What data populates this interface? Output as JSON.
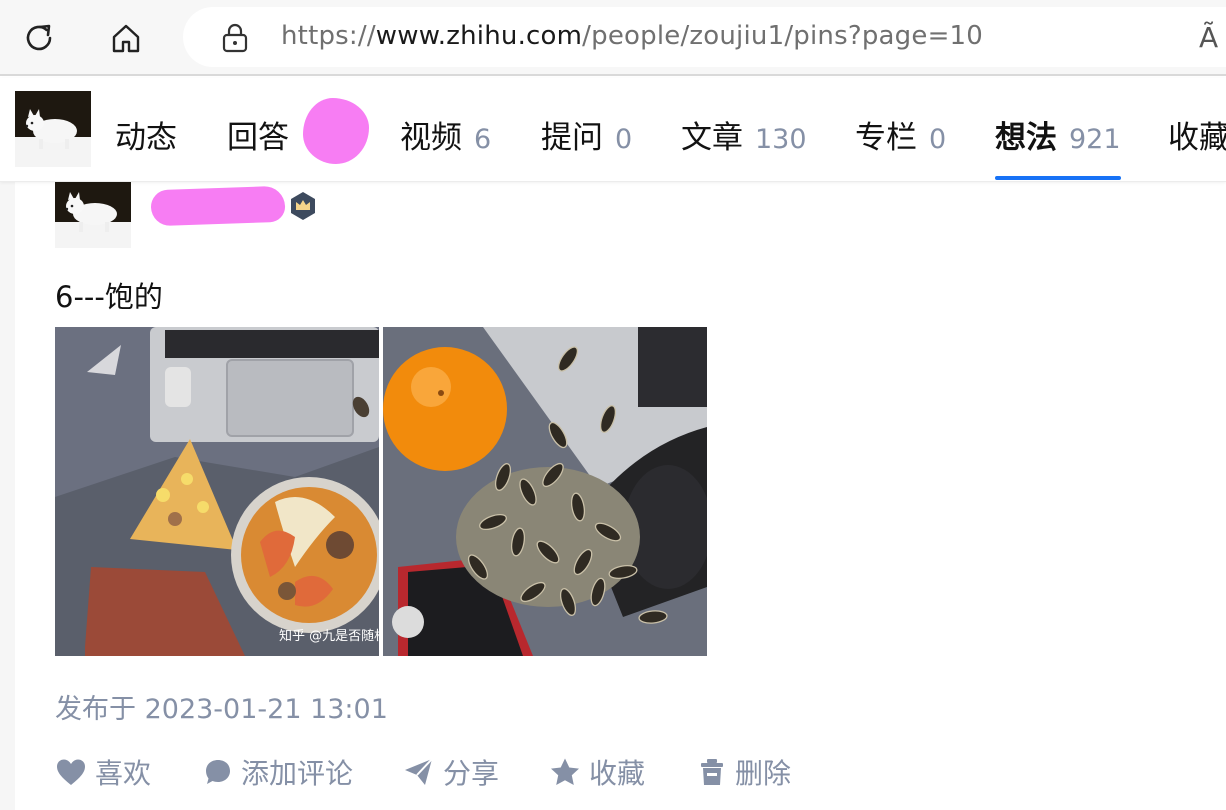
{
  "browser": {
    "url_scheme": "https://",
    "url_host": "www.zhihu.com",
    "url_path": "/people/zoujiu1/pins?page=10",
    "read_aloud_glyph": "Ã"
  },
  "profile_tabs": [
    {
      "label": "动态",
      "count": ""
    },
    {
      "label": "回答",
      "count": ""
    },
    {
      "label": "视频",
      "count": "6"
    },
    {
      "label": "提问",
      "count": "0"
    },
    {
      "label": "文章",
      "count": "130"
    },
    {
      "label": "专栏",
      "count": "0"
    },
    {
      "label": "想法",
      "count": "921",
      "active": true
    },
    {
      "label": "收藏",
      "count": ""
    }
  ],
  "post": {
    "text": "6---饱的",
    "image_watermark": "知乎 @九是否随机",
    "published": "发布于 2023-01-21 13:01"
  },
  "actions": {
    "like": "喜欢",
    "comment": "添加评论",
    "share": "分享",
    "favorite": "收藏",
    "delete": "删除"
  },
  "colors": {
    "accent": "#1772f6",
    "muted": "#8590a6",
    "redaction": "#f77df3"
  },
  "icons": [
    "reload-icon",
    "home-icon",
    "lock-icon",
    "read-aloud-icon",
    "crown-badge-icon",
    "heart-icon",
    "comment-bubble-icon",
    "send-icon",
    "star-icon",
    "trash-icon"
  ]
}
